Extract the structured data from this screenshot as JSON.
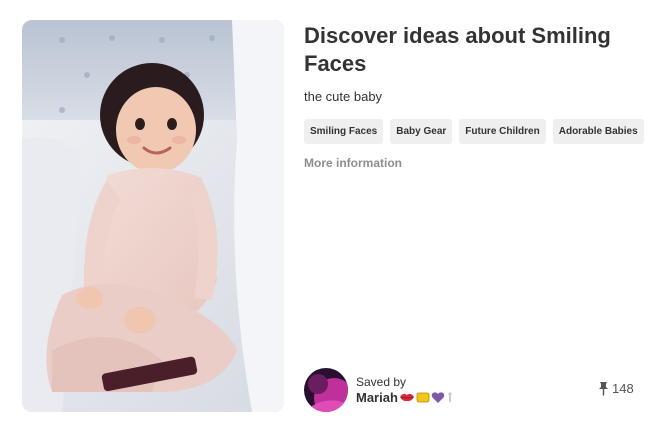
{
  "pin": {
    "image_alt": "the cute baby",
    "title": "Discover ideas about Smiling Faces",
    "description": "the cute baby",
    "more_info_label": "More information"
  },
  "tags": [
    {
      "label": "Smiling Faces"
    },
    {
      "label": "Baby Gear"
    },
    {
      "label": "Future Children"
    },
    {
      "label": "Adorable Babies"
    }
  ],
  "icons": {
    "tags_next": "chevron-right-icon",
    "repin": "pushpin-icon",
    "emojis": [
      "lips-emoji-icon",
      "yellow-heart-emoji-icon",
      "purple-heart-emoji-icon",
      "sparkle-emoji-icon"
    ]
  },
  "saver": {
    "saved_by_label": "Saved by",
    "name": "Mariah"
  },
  "stats": {
    "repin_count": "148"
  },
  "colors": {
    "tag_background": "#efefef",
    "text_primary": "#333333",
    "text_muted": "#8e8e8e",
    "avatar_accent": "#c0309a"
  }
}
